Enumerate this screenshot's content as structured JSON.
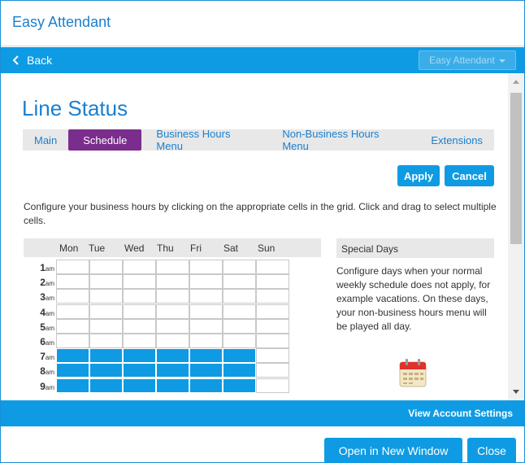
{
  "window": {
    "title": "Easy Attendant"
  },
  "nav": {
    "back_label": "Back",
    "app_selector": "Easy Attendant"
  },
  "page": {
    "title": "Line Status"
  },
  "tabs": [
    {
      "label": "Main",
      "active": false
    },
    {
      "label": "Schedule",
      "active": true
    },
    {
      "label": "Business Hours Menu",
      "active": false
    },
    {
      "label": "Non-Business Hours Menu",
      "active": false
    },
    {
      "label": "Extensions",
      "active": false
    }
  ],
  "actions": {
    "apply": "Apply",
    "cancel": "Cancel"
  },
  "description": "Configure your business hours by clicking on the appropriate cells in the grid. Click and drag to select multiple cells.",
  "schedule": {
    "days": [
      "Mon",
      "Tue",
      "Wed",
      "Thu",
      "Fri",
      "Sat",
      "Sun"
    ],
    "hours": [
      {
        "num": "1",
        "suffix": "am",
        "on": [
          false,
          false,
          false,
          false,
          false,
          false,
          false
        ]
      },
      {
        "num": "2",
        "suffix": "am",
        "on": [
          false,
          false,
          false,
          false,
          false,
          false,
          false
        ]
      },
      {
        "num": "3",
        "suffix": "am",
        "on": [
          false,
          false,
          false,
          false,
          false,
          false,
          false
        ]
      },
      {
        "num": "4",
        "suffix": "am",
        "on": [
          false,
          false,
          false,
          false,
          false,
          false,
          false
        ]
      },
      {
        "num": "5",
        "suffix": "am",
        "on": [
          false,
          false,
          false,
          false,
          false,
          false,
          false
        ]
      },
      {
        "num": "6",
        "suffix": "am",
        "on": [
          false,
          false,
          false,
          false,
          false,
          false,
          false
        ]
      },
      {
        "num": "7",
        "suffix": "am",
        "on": [
          true,
          true,
          true,
          true,
          true,
          true,
          false
        ]
      },
      {
        "num": "8",
        "suffix": "am",
        "on": [
          true,
          true,
          true,
          true,
          true,
          true,
          false
        ]
      },
      {
        "num": "9",
        "suffix": "am",
        "on": [
          true,
          true,
          true,
          true,
          true,
          true,
          false
        ]
      }
    ],
    "active_color": "#0f9be3"
  },
  "special_days": {
    "title": "Special Days",
    "text": "Configure days when your normal weekly schedule does not apply, for example vacations. On these days, your non-business hours menu will be played all day.",
    "icon": "calendar-icon"
  },
  "footer": {
    "account_link": "View Account Settings",
    "open_new_window": "Open in New Window",
    "close": "Close"
  },
  "colors": {
    "brand": "#0f9be3",
    "title": "#1a7fcf",
    "active_tab": "#7a2d8c"
  }
}
